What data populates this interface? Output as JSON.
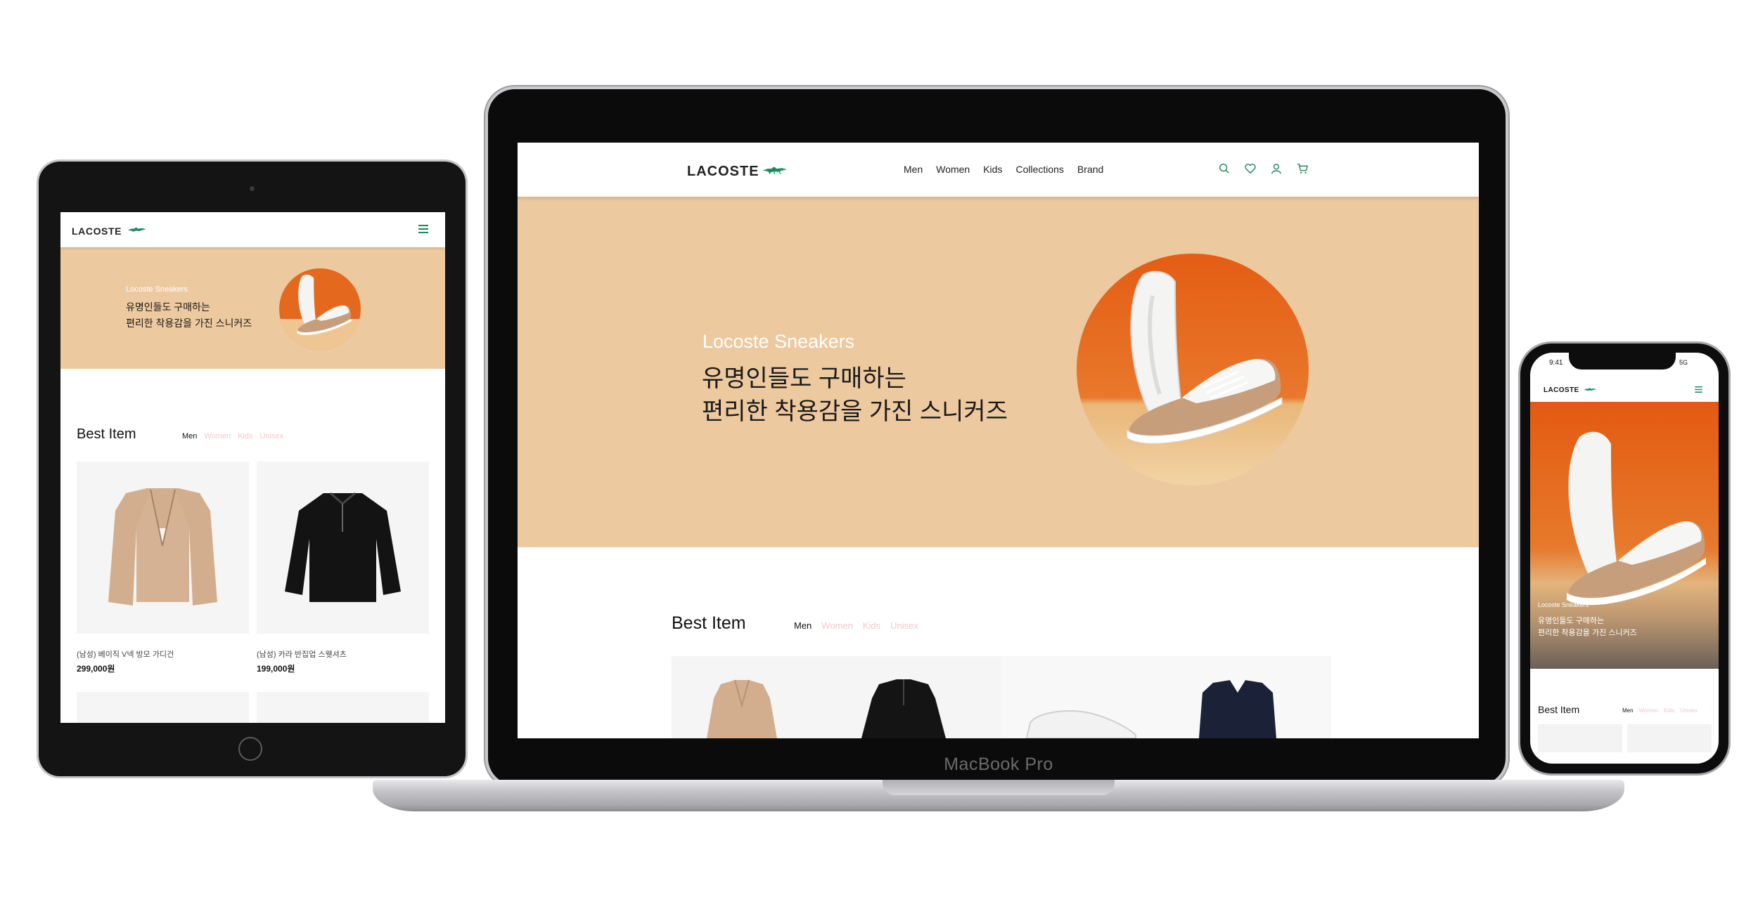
{
  "site": {
    "logo": "LACOSTE",
    "nav": [
      "Men",
      "Women",
      "Kids",
      "Collections",
      "Brand"
    ],
    "hero": {
      "subtitle": "Locoste Sneakers",
      "headline_line1": "유명인들도 구매하는",
      "headline_line2": "편리한 착용감을 가진 스니커즈"
    },
    "best": {
      "title": "Best Item",
      "tabs": [
        "Men",
        "Women",
        "Kids",
        "Unisex"
      ]
    },
    "products": [
      {
        "name": "(남성) 베이직 V넥 방모 가디건",
        "price": "299,000원"
      },
      {
        "name": "(남성) 카라 반집업 스웻셔츠",
        "price": "199,000원"
      }
    ]
  },
  "devices": {
    "laptop_label": "MacBook Pro",
    "phone_time": "9:41",
    "phone_status": "5G"
  },
  "colors": {
    "hero_bg": "#edc99f",
    "accent_green": "#1f8a5f",
    "tab_inactive": "#f2c7cf"
  }
}
